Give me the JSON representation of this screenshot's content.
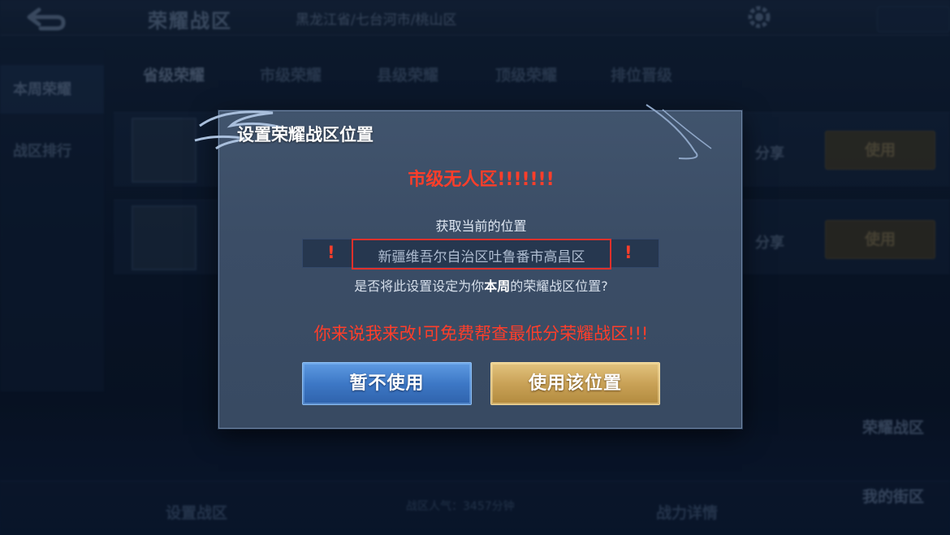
{
  "background": {
    "header_title": "荣耀战区",
    "location_breadcrumb": "黑龙江省/七台河市/桃山区",
    "tabs": [
      "省级荣耀",
      "市级荣耀",
      "县级荣耀",
      "顶级荣耀",
      "排位晋级"
    ],
    "left_nav": [
      "本周荣耀",
      "战区排行"
    ],
    "share_label": "分享",
    "use_label": "使用",
    "bottom_tabs": [
      "设置战区",
      "战力详情"
    ],
    "popularity_text": "战区人气：3457分钟",
    "right_badges": [
      "荣耀战区",
      "我的街区"
    ]
  },
  "dialog": {
    "title": "设置荣耀战区位置",
    "headline": "市级无人区!!!!!!!",
    "get_location_label": "获取当前的位置",
    "location_value": "新疆维吾尔自治区吐鲁番市高昌区",
    "exclam_left": "!",
    "exclam_right": "!",
    "question_prefix": "是否将此设置设定为你",
    "question_emph": "本周",
    "question_suffix": "的荣耀战区位置?",
    "promo": "你来说我来改!可免费帮查最低分荣耀战区!!!",
    "cancel_button": "暂不使用",
    "confirm_button": "使用该位置"
  },
  "colors": {
    "warning_red": "#ff3e2a",
    "cancel_blue": "#3d78c6",
    "confirm_gold": "#c9a257",
    "dialog_bg": "#3b4d66"
  }
}
